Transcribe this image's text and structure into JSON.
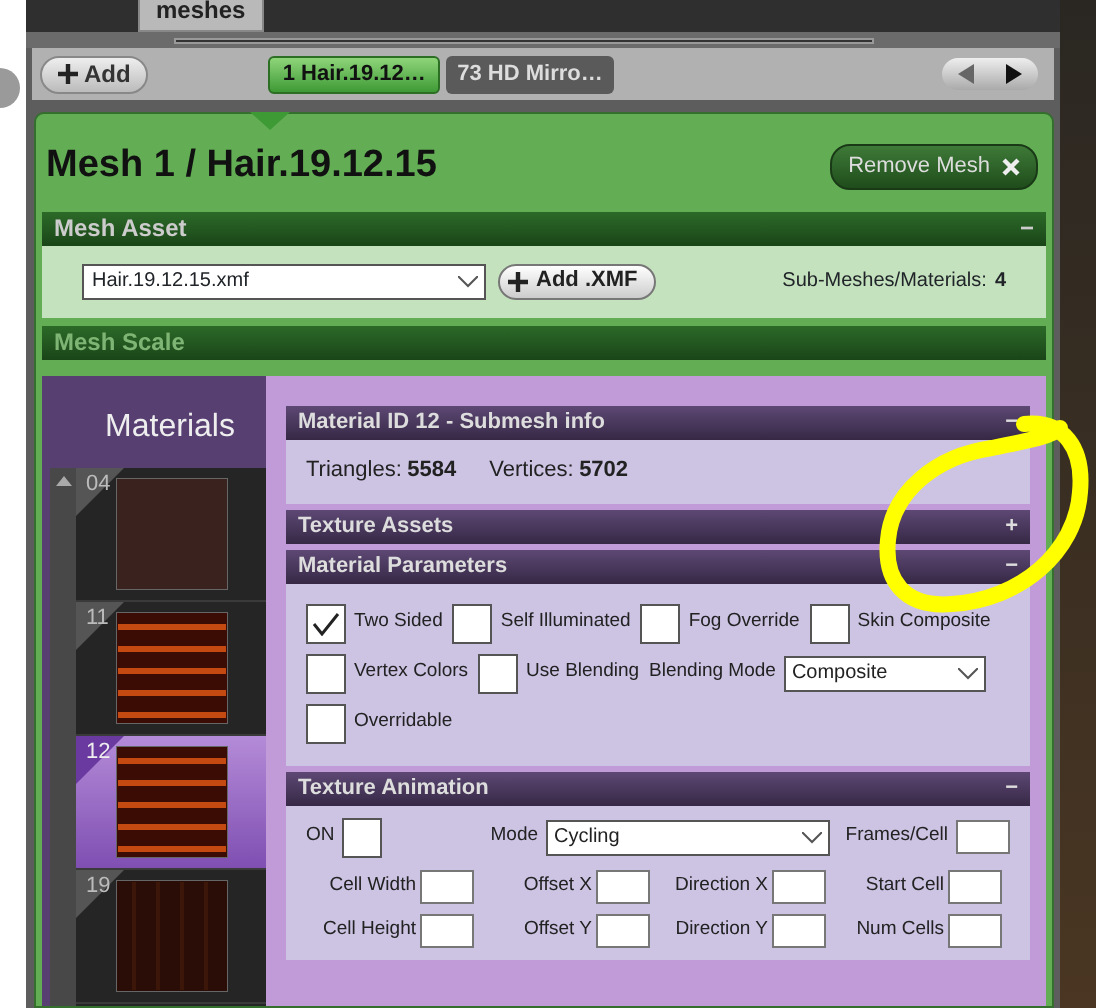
{
  "top_tabs": [
    {
      "label": "meshes",
      "selected": true
    }
  ],
  "toolbar": {
    "add_button": "Add",
    "mesh_tabs": [
      {
        "label": "1 Hair.19.12…",
        "selected": true
      },
      {
        "label": "73 HD Mirro…",
        "selected": false
      }
    ]
  },
  "mesh": {
    "title": "Mesh 1 / Hair.19.12.15",
    "remove_button": "Remove Mesh"
  },
  "mesh_asset": {
    "title": "Mesh Asset",
    "toggle": "−",
    "file": "Hair.19.12.15.xmf",
    "add_button": "Add .XMF",
    "count_label": "Sub-Meshes/Materials:",
    "count": "4"
  },
  "mesh_scale": {
    "title": "Mesh Scale",
    "disabled": true
  },
  "materials": {
    "title": "Materials",
    "items": [
      {
        "number": "04",
        "selected": false,
        "kind": "plain"
      },
      {
        "number": "11",
        "selected": false,
        "kind": "striped"
      },
      {
        "number": "12",
        "selected": true,
        "kind": "striped"
      },
      {
        "number": "19",
        "selected": false,
        "kind": "dark"
      }
    ]
  },
  "submesh_info": {
    "title": "Material ID 12 - Submesh info",
    "toggle": "−",
    "triangles_label": "Triangles:",
    "triangles": "5584",
    "vertices_label": "Vertices:",
    "vertices": "5702"
  },
  "texture_assets": {
    "title": "Texture Assets",
    "toggle": "+"
  },
  "material_parameters": {
    "title": "Material Parameters",
    "toggle": "−",
    "rows": [
      [
        {
          "kind": "checkbox",
          "label": "Two Sided",
          "checked": true
        },
        {
          "kind": "checkbox",
          "label": "Self Illuminated",
          "checked": false
        },
        {
          "kind": "checkbox",
          "label": "Fog Override",
          "checked": false
        },
        {
          "kind": "checkbox",
          "label": "Skin Composite",
          "checked": false
        }
      ],
      [
        {
          "kind": "checkbox",
          "label": "Vertex Colors",
          "checked": false
        },
        {
          "kind": "checkbox",
          "label": "Use Blending",
          "checked": false
        },
        {
          "kind": "select",
          "label": "Blending Mode",
          "value": "Composite"
        }
      ],
      [
        {
          "kind": "checkbox",
          "label": "Overridable",
          "checked": false
        }
      ]
    ]
  },
  "texture_animation": {
    "title": "Texture Animation",
    "toggle": "−",
    "on": {
      "label": "ON",
      "checked": false
    },
    "mode": {
      "label": "Mode",
      "value": "Cycling"
    },
    "frames_label": "Frames/Cell",
    "fields": [
      "Cell Width",
      "Offset X",
      "Direction X",
      "Start Cell",
      "Cell Height",
      "Offset Y",
      "Direction Y",
      "Num Cells"
    ]
  }
}
